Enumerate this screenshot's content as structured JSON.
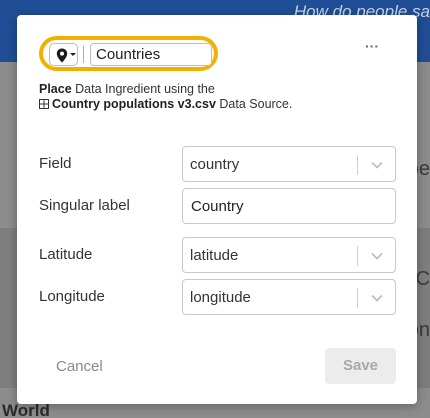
{
  "background": {
    "header_text": "How do people sa",
    "right_fragments": [
      "oe",
      "C",
      "on"
    ],
    "world_label": "World"
  },
  "modal": {
    "ingredient_icon": "map-pin-icon",
    "ingredient_name": "Countries",
    "more_label": "···",
    "description": {
      "action": "Place",
      "middle": "Data Ingredient using the",
      "source_icon": "table-grid-icon",
      "source_name": "Country populations v3.csv",
      "suffix": "Data Source."
    },
    "fields": [
      {
        "label": "Field",
        "type": "select",
        "value": "country"
      },
      {
        "label": "Singular label",
        "type": "text",
        "value": "Country"
      },
      {
        "label": "Latitude",
        "type": "select",
        "value": "latitude"
      },
      {
        "label": "Longitude",
        "type": "select",
        "value": "longitude"
      }
    ],
    "cancel_label": "Cancel",
    "save_label": "Save"
  },
  "colors": {
    "accent": "#f2b100",
    "header": "#1f4e96"
  }
}
